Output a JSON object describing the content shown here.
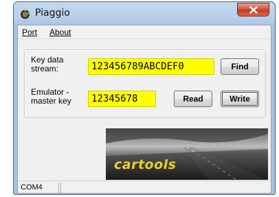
{
  "window": {
    "title": "Piaggio"
  },
  "menu": {
    "port": "Port",
    "about": "About"
  },
  "key_data": {
    "label": "Key data\nstream:",
    "value": "123456789ABCDEF0"
  },
  "emulator": {
    "label": "Emulator -\nmaster key",
    "value": "12345678"
  },
  "buttons": {
    "find": "Find",
    "read": "Read",
    "write": "Write"
  },
  "banner": {
    "text": "cartools"
  },
  "status": {
    "port": "COM4"
  },
  "colors": {
    "field_bg": "#ffff00",
    "close_button": "#c9462c"
  },
  "icons": {
    "app": "app-icon",
    "close": "close-icon"
  }
}
